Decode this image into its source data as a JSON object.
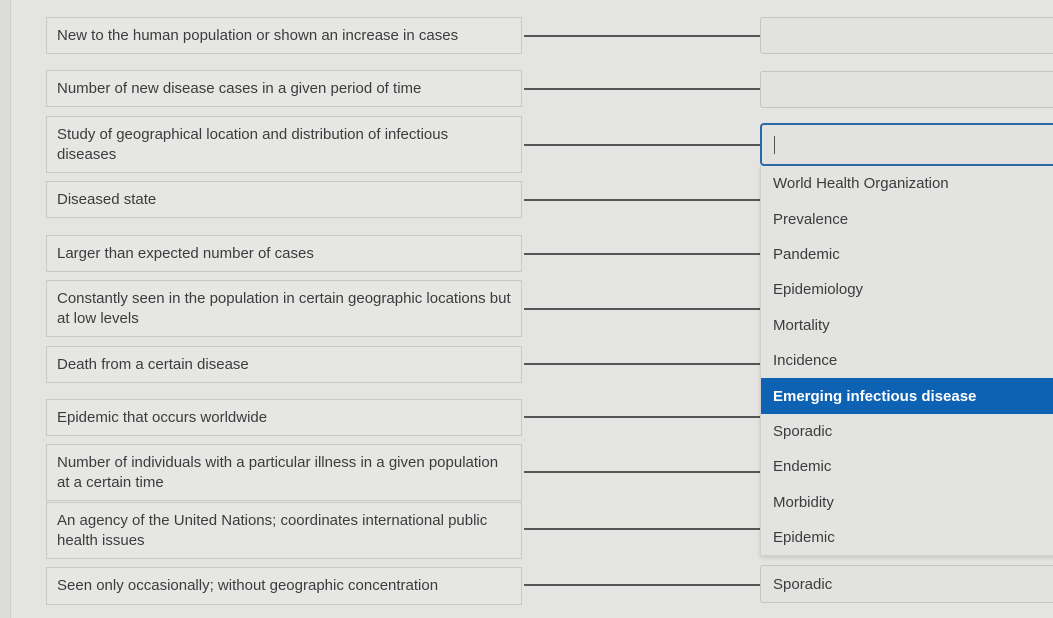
{
  "prompts": [
    {
      "text": "New to the human population or shown an increase in cases",
      "answer": ""
    },
    {
      "text": "Number of new disease cases in a given period of time",
      "answer": ""
    },
    {
      "text": "Study of geographical location and distribution of infectious diseases",
      "answer": ""
    },
    {
      "text": "Diseased state",
      "answer": ""
    },
    {
      "text": "Larger than expected number of cases",
      "answer": ""
    },
    {
      "text": "Constantly seen in the population in certain geographic locations but at low levels",
      "answer": ""
    },
    {
      "text": "Death from a certain disease",
      "answer": ""
    },
    {
      "text": "Epidemic that occurs worldwide",
      "answer": ""
    },
    {
      "text": "Number of individuals with a particular illness in a given population at a certain time",
      "answer": ""
    },
    {
      "text": "An agency of the United Nations; coordinates international public health issues",
      "answer": ""
    },
    {
      "text": "Seen only occasionally; without geographic concentration",
      "answer": "Sporadic"
    }
  ],
  "dropdown": {
    "open_for_prompt_index": 2,
    "highlighted_index": 6,
    "options": [
      "World Health Organization",
      "Prevalence",
      "Pandemic",
      "Epidemiology",
      "Mortality",
      "Incidence",
      "Emerging infectious disease",
      "Sporadic",
      "Endemic",
      "Morbidity",
      "Epidemic"
    ]
  },
  "colors": {
    "highlight": "#0d62b3",
    "focus_border": "#2c6aa6"
  }
}
